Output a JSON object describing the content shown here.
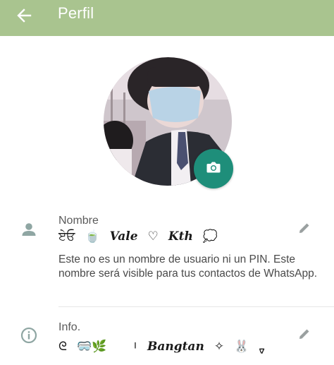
{
  "colors": {
    "appbar": "#a9c48f",
    "accent": "#1e8e7a",
    "icon_gray": "#8fa6a3"
  },
  "header": {
    "title": "Perfil",
    "back_icon": "arrow-left-icon"
  },
  "avatar": {
    "camera_icon": "camera-icon"
  },
  "name_row": {
    "icon": "person-icon",
    "label": "Nombre",
    "value_parts": [
      "ਏਓ",
      "🍵",
      "Vale",
      "♡",
      "Kth",
      "💭"
    ],
    "hint": "Este no es un nombre de usuario ni un PIN. Este nombre será visible para tus contactos de WhatsApp.",
    "edit_icon": "pencil-icon"
  },
  "info_row": {
    "icon": "info-icon",
    "label": "Info.",
    "value_parts": [
      "ᘓ",
      "🥽🌿",
      "ᅵ",
      "Bangtan",
      "✧",
      "🐰",
      "ᢦ"
    ],
    "edit_icon": "pencil-icon"
  }
}
